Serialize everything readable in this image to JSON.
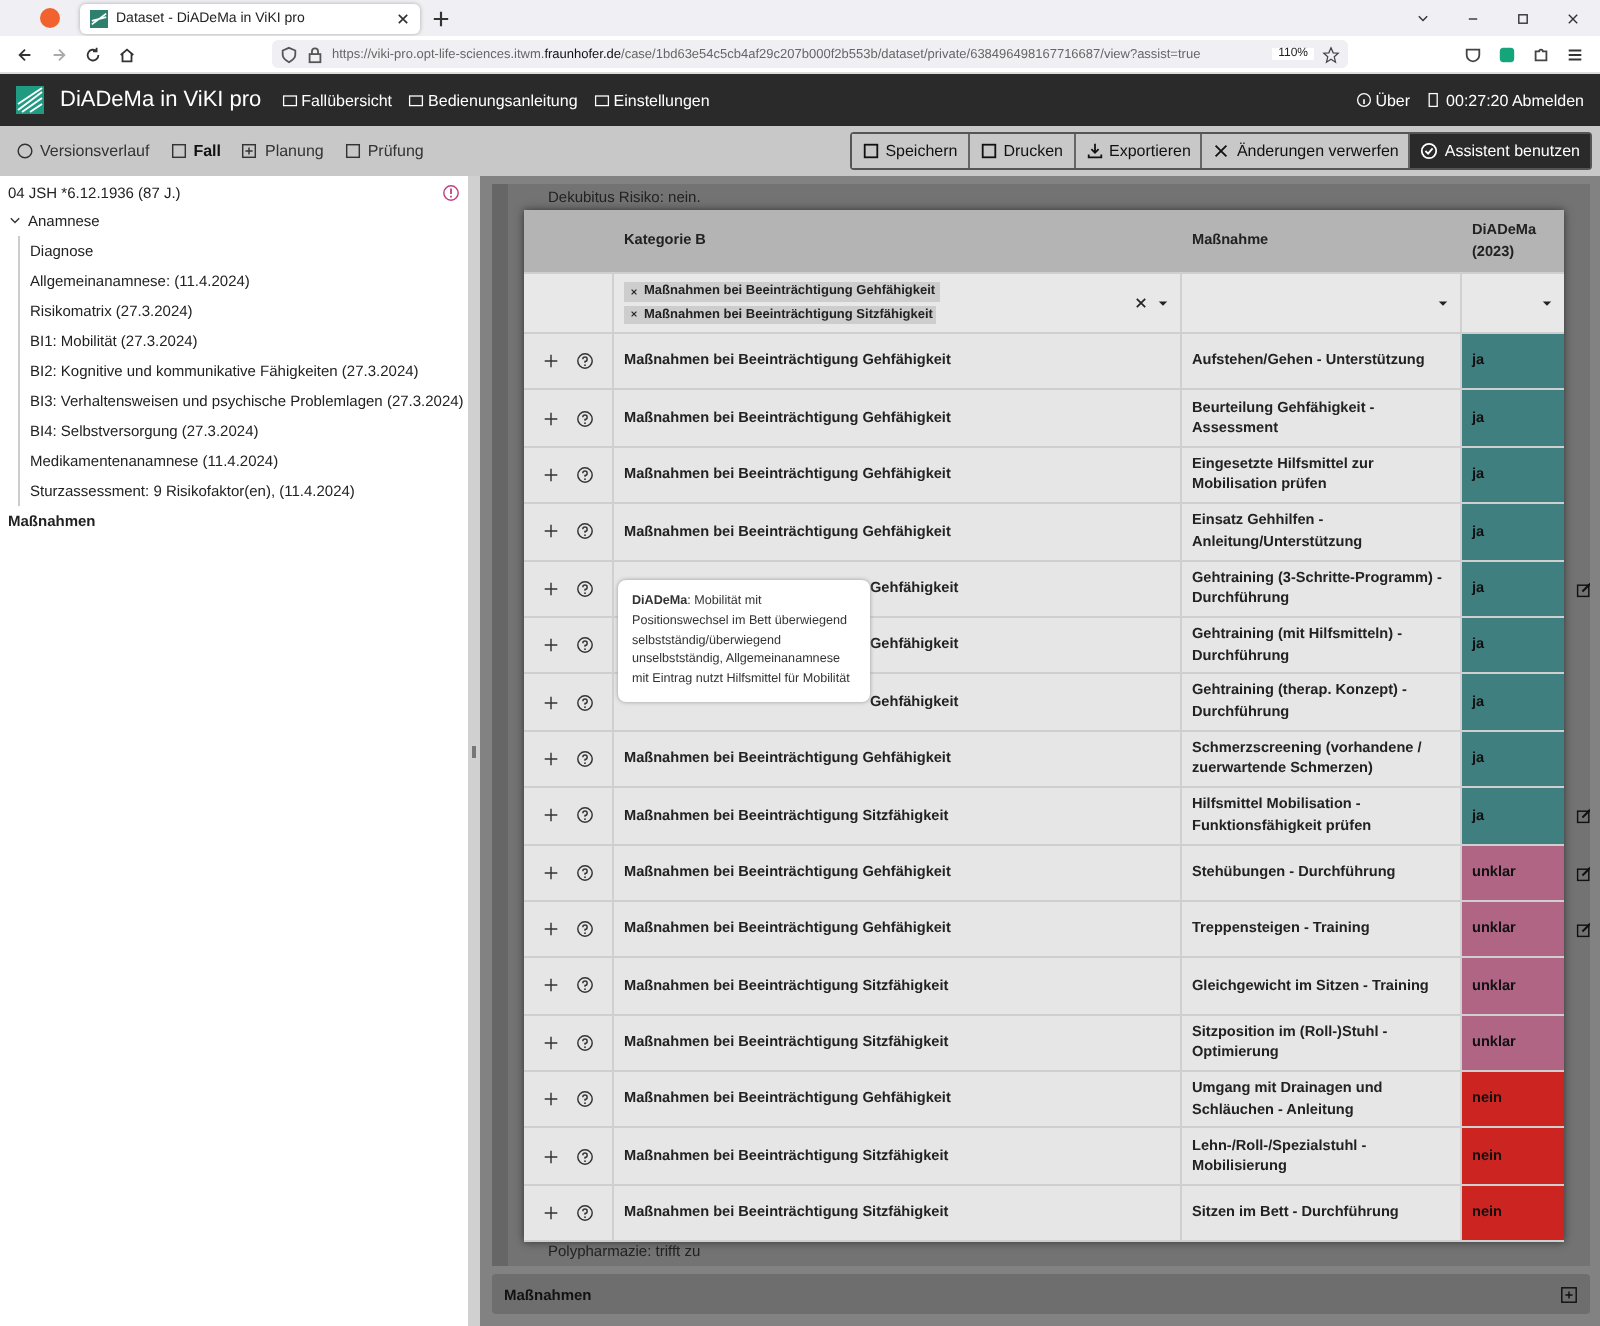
{
  "browser": {
    "tab_title": "Dataset - DiADeMa in ViKI pro",
    "url_prefix": "https://viki-pro.opt-life-sciences.itwm.",
    "url_domain": "fraunhofer.de",
    "url_rest": "/case/1bd63e54c5cb4af29c207b000f2b553b/dataset/private/638496498167716687/view?assist=true",
    "zoom": "110%"
  },
  "header": {
    "logo": "DiADeMa in ViKI pro",
    "nav": [
      "Fallübersicht",
      "Bedienungsanleitung",
      "Einstellungen"
    ],
    "about": "Über",
    "session": "00:27:20 Abmelden"
  },
  "toolbar": {
    "tabs": [
      {
        "label": "Versionsverlauf",
        "selected": false
      },
      {
        "label": "Fall",
        "selected": true
      },
      {
        "label": "Planung",
        "selected": false
      },
      {
        "label": "Prüfung",
        "selected": false
      }
    ],
    "actions": [
      {
        "label": "Speichern",
        "selected": false
      },
      {
        "label": "Drucken",
        "selected": false
      },
      {
        "label": "Exportieren",
        "selected": false
      },
      {
        "label": "Änderungen verwerfen",
        "selected": false
      },
      {
        "label": "Assistent benutzen",
        "selected": true
      }
    ]
  },
  "sidebar": {
    "patient": "04 JSH *6.12.1936 (87 J.)",
    "tree": [
      {
        "label": "Anamnese",
        "expanded": true,
        "selected": false,
        "children": [
          {
            "label": "Diagnose"
          },
          {
            "label": "Allgemeinanamnese: (11.4.2024)"
          },
          {
            "label": "Risikomatrix (27.3.2024)"
          },
          {
            "label": "BI1: Mobilität (27.3.2024)"
          },
          {
            "label": "BI2: Kognitive und kommunikative Fähigkeiten (27.3.2024)"
          },
          {
            "label": "BI3: Verhaltensweisen und psychische Problemlagen (27.3.2024)"
          },
          {
            "label": "BI4: Selbstversorgung (27.3.2024)"
          },
          {
            "label": "Medikamentenanamnese (11.4.2024)"
          },
          {
            "label": "Sturzassessment: 9 Risikofaktor(en), (11.4.2024)"
          }
        ]
      },
      {
        "label": "Maßnahmen",
        "selected": true
      }
    ]
  },
  "content": {
    "top_text": "Dekubitus Risiko: nein.",
    "bottom_text": "Polypharmazie: trifft zu",
    "section": "Maßnahmen"
  },
  "table": {
    "columns": [
      "Kategorie B",
      "Maßnahme",
      "DiADeMa (2023)"
    ],
    "filter_chips": [
      "Maßnahmen bei Beeinträchtigung Gehfähigkeit",
      "Maßnahmen bei Beeinträchtigung Sitzfähigkeit"
    ],
    "rows": [
      {
        "category": "Maßnahmen bei Beeinträchtigung Gehfähigkeit",
        "covered": false,
        "measure": "Aufstehen/Gehen - Unterstützung",
        "value": "ja",
        "color": "#3f7f80",
        "edited": false
      },
      {
        "category": "Maßnahmen bei Beeinträchtigung Gehfähigkeit",
        "covered": false,
        "measure": "Beurteilung Gehfähigkeit - Assessment",
        "value": "ja",
        "color": "#3f7f80",
        "edited": false
      },
      {
        "category": "Maßnahmen bei Beeinträchtigung Gehfähigkeit",
        "covered": false,
        "measure": "Eingesetzte Hilfsmittel zur Mobilisation prüfen",
        "value": "ja",
        "color": "#3f7f80",
        "edited": false
      },
      {
        "category": "Maßnahmen bei Beeinträchtigung Gehfähigkeit",
        "covered": false,
        "measure": "Einsatz Gehhilfen - Anleitung/Unterstützung",
        "value": "ja",
        "color": "#3f7f80",
        "edited": false
      },
      {
        "category": "Gehfähigkeit",
        "covered": true,
        "measure": "Gehtraining (3-Schritte-Programm) - Durchführung",
        "value": "ja",
        "color": "#3f7f80",
        "edited": true
      },
      {
        "category": "Gehfähigkeit",
        "covered": true,
        "measure": "Gehtraining (mit Hilfsmitteln) - Durchführung",
        "value": "ja",
        "color": "#3f7f80",
        "edited": false
      },
      {
        "category": "Gehfähigkeit",
        "covered": true,
        "measure": "Gehtraining (therap. Konzept) - Durchführung",
        "value": "ja",
        "color": "#3f7f80",
        "edited": false
      },
      {
        "category": "Maßnahmen bei Beeinträchtigung Gehfähigkeit",
        "covered": false,
        "measure": "Schmerzscreening (vorhandene / zuerwartende Schmerzen)",
        "value": "ja",
        "color": "#3f7f80",
        "edited": false
      },
      {
        "category": "Maßnahmen bei Beeinträchtigung Sitzfähigkeit",
        "covered": false,
        "measure": "Hilfsmittel Mobilisation - Funktionsfähigkeit prüfen",
        "value": "ja",
        "color": "#3f7f80",
        "edited": true
      },
      {
        "category": "Maßnahmen bei Beeinträchtigung Gehfähigkeit",
        "covered": false,
        "measure": "Stehübungen - Durchführung",
        "value": "unklar",
        "color": "#b06585",
        "edited": true
      },
      {
        "category": "Maßnahmen bei Beeinträchtigung Gehfähigkeit",
        "covered": false,
        "measure": "Treppensteigen - Training",
        "value": "unklar",
        "color": "#b06585",
        "edited": true
      },
      {
        "category": "Maßnahmen bei Beeinträchtigung Sitzfähigkeit",
        "covered": false,
        "measure": "Gleichgewicht im Sitzen - Training",
        "value": "unklar",
        "color": "#b06585",
        "edited": false
      },
      {
        "category": "Maßnahmen bei Beeinträchtigung Sitzfähigkeit",
        "covered": false,
        "measure": "Sitzposition im (Roll-)Stuhl - Optimierung",
        "value": "unklar",
        "color": "#b06585",
        "edited": false
      },
      {
        "category": "Maßnahmen bei Beeinträchtigung Gehfähigkeit",
        "covered": false,
        "measure": "Umgang mit Drainagen und Schläuchen - Anleitung",
        "value": "nein",
        "color": "#cc2420",
        "edited": false
      },
      {
        "category": "Maßnahmen bei Beeinträchtigung Sitzfähigkeit",
        "covered": false,
        "measure": "Lehn-/Roll-/Spezialstuhl - Mobilisierung",
        "value": "nein",
        "color": "#cc2420",
        "edited": false
      },
      {
        "category": "Maßnahmen bei Beeinträchtigung Sitzfähigkeit",
        "covered": false,
        "measure": "Sitzen im Bett - Durchführung",
        "value": "nein",
        "color": "#cc2420",
        "edited": false
      }
    ],
    "tooltip": "**DiADeMa**: Mobilität mit Positionswechsel im Bett überwiegend selbstständig/überwiegend unselbstständig, Allgemeinanamnese mit Eintrag nutzt Hilfsmittel für Mobilität"
  }
}
